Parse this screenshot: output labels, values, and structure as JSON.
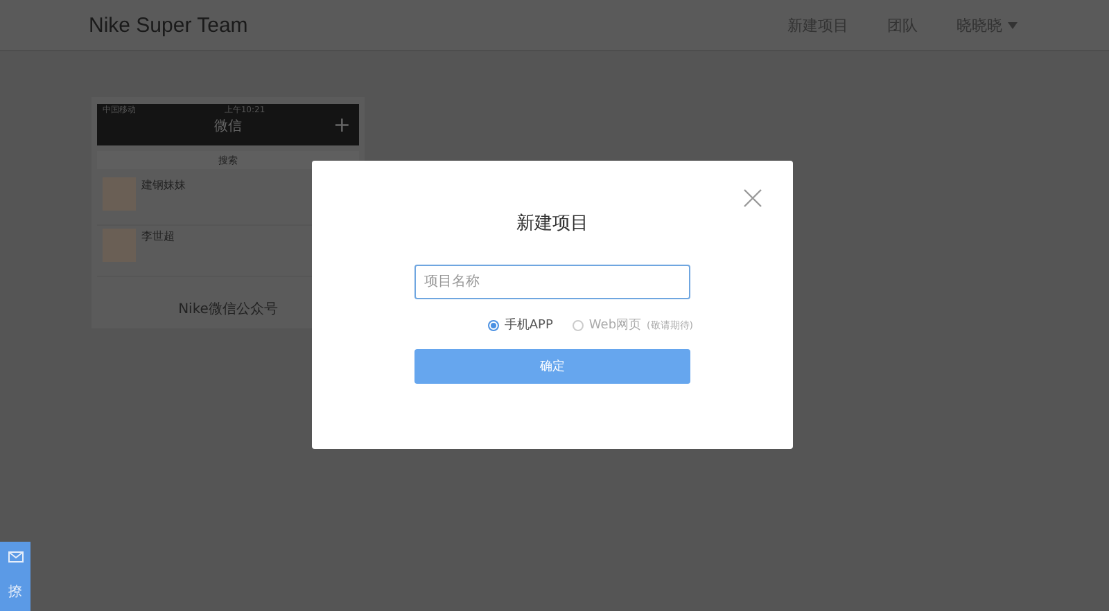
{
  "navbar": {
    "brand": "Nike Super Team",
    "links": [
      {
        "label": "新建项目"
      },
      {
        "label": "团队"
      }
    ],
    "user_menu": "晓晓晓"
  },
  "preview_card": {
    "status_bar": {
      "carrier": "中国移动",
      "time": "上午10:21"
    },
    "title": "微信",
    "add": "+",
    "search": "搜索",
    "chats": [
      {
        "name": "建钢妹妹"
      },
      {
        "name": "李世超"
      }
    ],
    "caption": "Nike微信公众号"
  },
  "dialog": {
    "title": "新建项目",
    "name_field": {
      "placeholder": "项目名称"
    },
    "options": [
      {
        "label": "手机APP",
        "selected": true,
        "disabled": false
      },
      {
        "label": "Web网页",
        "note": "(敬请期待)",
        "selected": false,
        "disabled": true
      }
    ],
    "confirm": "确定"
  },
  "feedback": {
    "label": "撩"
  }
}
